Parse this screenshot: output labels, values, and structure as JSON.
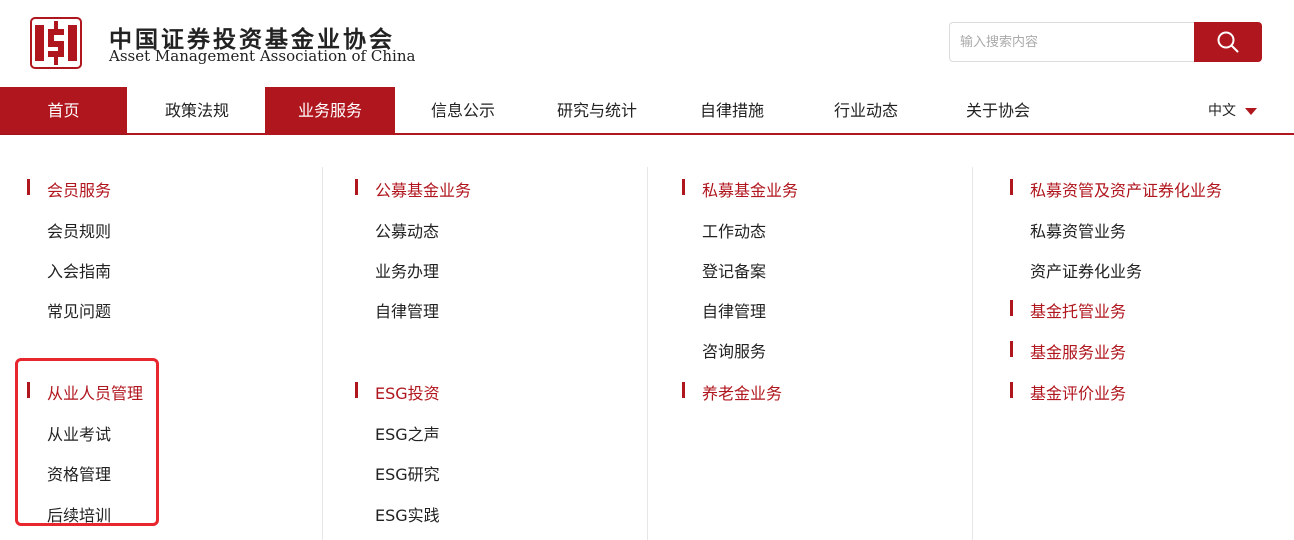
{
  "brand": {
    "name_cn": "中国证券投资基金业协会",
    "name_en": "Asset Management Association of China",
    "logo_icon": "amac-seal-logo",
    "accent_color": "#b0161e"
  },
  "search": {
    "placeholder": "输入搜索内容",
    "button_icon": "search-icon"
  },
  "nav": {
    "items": [
      "首页",
      "政策法规",
      "业务服务",
      "信息公示",
      "研究与统计",
      "自律措施",
      "行业动态",
      "关于协会"
    ],
    "active": "业务服务",
    "language": "中文"
  },
  "menu": {
    "col1": {
      "group1": {
        "title": "会员服务",
        "links": [
          "会员规则",
          "入会指南",
          "常见问题"
        ]
      },
      "group2": {
        "title": "从业人员管理",
        "links": [
          "从业考试",
          "资格管理",
          "后续培训"
        ]
      }
    },
    "col2": {
      "group1": {
        "title": "公募基金业务",
        "links": [
          "公募动态",
          "业务办理",
          "自律管理"
        ]
      },
      "group2": {
        "title": "ESG投资",
        "links": [
          "ESG之声",
          "ESG研究",
          "ESG实践"
        ]
      }
    },
    "col3": {
      "group1": {
        "title": "私募基金业务",
        "links": [
          "工作动态",
          "登记备案",
          "自律管理",
          "咨询服务"
        ]
      },
      "group2": {
        "title": "养老金业务"
      }
    },
    "col4": {
      "group1": {
        "title": "私募资管及资产证券化业务",
        "links": [
          "私募资管业务",
          "资产证券化业务"
        ]
      },
      "group2": {
        "title": "基金托管业务"
      },
      "group3": {
        "title": "基金服务业务"
      },
      "group4": {
        "title": "基金评价业务"
      }
    }
  }
}
